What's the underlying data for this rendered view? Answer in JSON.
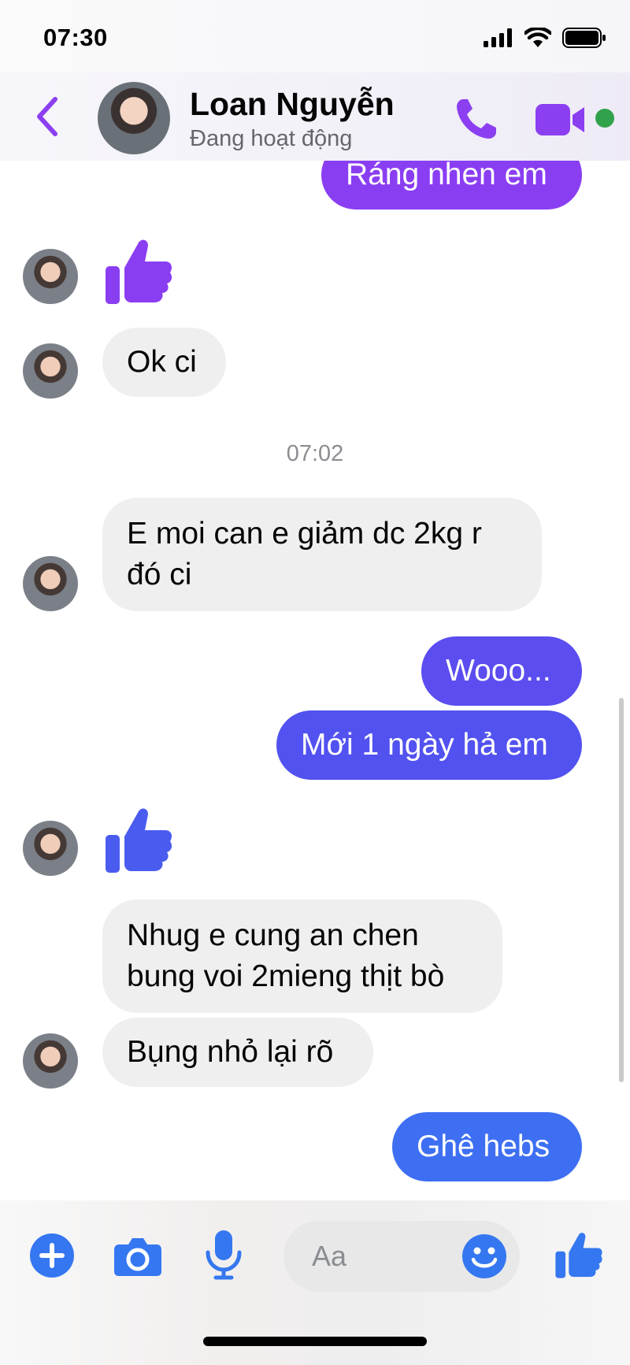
{
  "status_bar": {
    "time": "07:30",
    "icons": [
      "cellular-signal-icon",
      "wifi-icon",
      "battery-icon"
    ]
  },
  "header": {
    "back_icon": "chevron-left-icon",
    "contact_name": "Loan Nguyễn",
    "contact_status": "Đang hoạt động",
    "call_icon": "phone-icon",
    "video_icon": "video-camera-icon",
    "online_indicator_color": "#31a24c"
  },
  "colors": {
    "accent_purple": "#8b3ff0",
    "bubble_purple": "#8a3ef2",
    "bubble_indigo": "#5b4df0",
    "bubble_blue": "#3e6ff2",
    "incoming_bubble": "#efefef",
    "composer_blue": "#3577f0"
  },
  "messages": [
    {
      "id": "m1",
      "direction": "outgoing",
      "text": "Ráng nhen em"
    },
    {
      "id": "m2",
      "direction": "incoming",
      "type": "like",
      "icon": "thumbs-up-icon"
    },
    {
      "id": "m3",
      "direction": "incoming",
      "text": "Ok ci"
    },
    {
      "id": "ts",
      "type": "timestamp",
      "text": "07:02"
    },
    {
      "id": "m4",
      "direction": "incoming",
      "lines": [
        "E moi can e giảm dc 2kg r",
        "đó ci"
      ]
    },
    {
      "id": "m5",
      "direction": "outgoing",
      "text": "Wooo..."
    },
    {
      "id": "m6",
      "direction": "outgoing",
      "text": "Mới 1 ngày hả em"
    },
    {
      "id": "m7",
      "direction": "incoming",
      "type": "like",
      "icon": "thumbs-up-icon"
    },
    {
      "id": "m8",
      "direction": "incoming",
      "lines": [
        "Nhug e cung an chen",
        "bung voi 2mieng thịt bò"
      ]
    },
    {
      "id": "m9",
      "direction": "incoming",
      "text": "Bụng nhỏ lại rõ"
    },
    {
      "id": "m10",
      "direction": "outgoing",
      "text": "Ghê hebs"
    }
  ],
  "composer": {
    "add_icon": "plus-circle-icon",
    "camera_icon": "camera-icon",
    "mic_icon": "microphone-icon",
    "input_placeholder": "Aa",
    "input_value": "",
    "emoji_icon": "smiley-icon",
    "like_icon": "thumbs-up-icon"
  }
}
